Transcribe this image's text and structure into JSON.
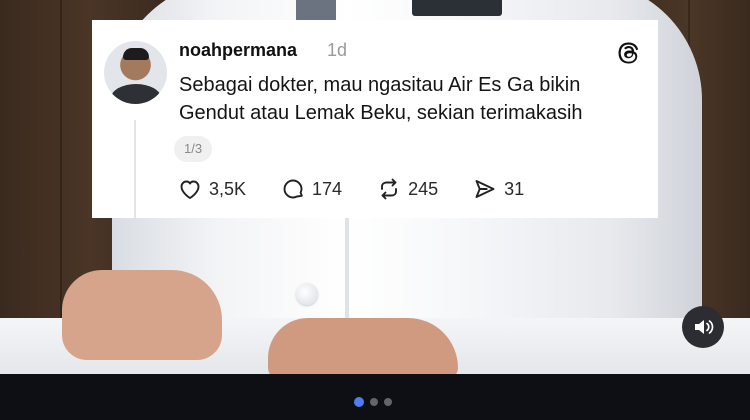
{
  "post": {
    "username": "noahpermana",
    "time": "1d",
    "text": "Sebagai dokter, mau ngasitau Air Es Ga bikin Gendut atau Lemak Beku, sekian terimakasih",
    "page_indicator": "1/3"
  },
  "actions": {
    "likes": "3,5K",
    "replies": "174",
    "reposts": "245",
    "shares": "31"
  },
  "icons": {
    "logo": "threads-logo-icon",
    "like": "heart-icon",
    "reply": "speech-bubble-icon",
    "repost": "repost-icon",
    "share": "send-icon",
    "sound": "speaker-icon"
  },
  "carousel": {
    "total": 3,
    "active_index": 0
  },
  "colors": {
    "card_bg": "#ffffff",
    "active_dot": "#4f7df5",
    "inactive_dot": "#62656d"
  }
}
